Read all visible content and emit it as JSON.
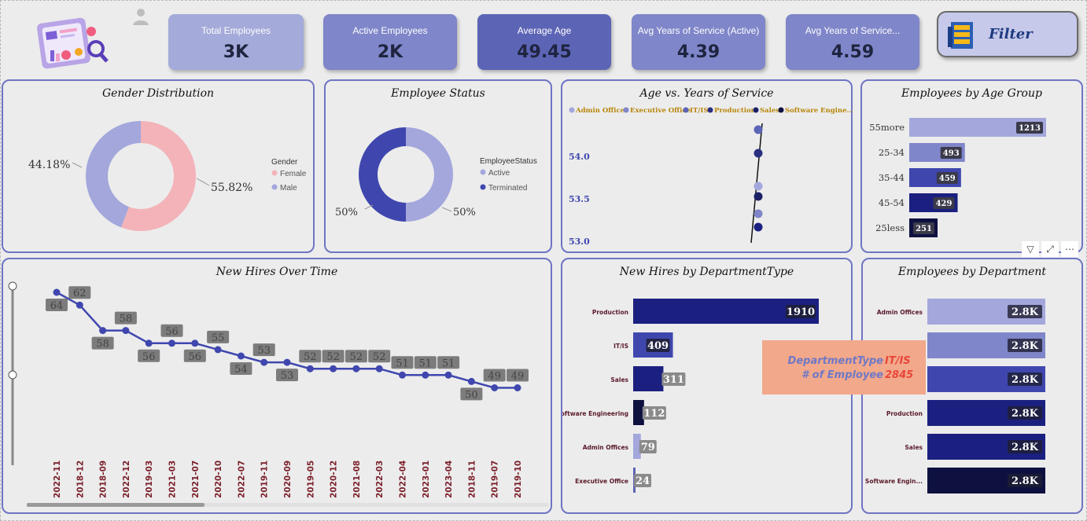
{
  "kpis": [
    {
      "label": "Total Employees",
      "value": "3K",
      "color": "#a4aad9"
    },
    {
      "label": "Active Employees",
      "value": "2K",
      "color": "#7f86c9"
    },
    {
      "label": "Average Age",
      "value": "49.45",
      "color": "#5c64b5"
    },
    {
      "label": "Avg Years of Service (Active)",
      "value": "4.39",
      "color": "#7f86c9"
    },
    {
      "label": "Avg Years of Service...",
      "value": "4.59",
      "color": "#7f86c9"
    }
  ],
  "filter": {
    "label": "Filter",
    "icon": "filter-panel-icon"
  },
  "gender": {
    "title": "Gender Distribution",
    "legend_title": "Gender",
    "items": [
      {
        "name": "Female",
        "pct": 55.82,
        "label": "55.82%",
        "color": "#f3b3b9"
      },
      {
        "name": "Male",
        "pct": 44.18,
        "label": "44.18%",
        "color": "#a3a7dc"
      }
    ]
  },
  "status": {
    "title": "Employee Status",
    "legend_title": "EmployeeStatus",
    "items": [
      {
        "name": "Active",
        "pct": 50,
        "label": "50%",
        "color": "#a3a7dc"
      },
      {
        "name": "Terminated",
        "pct": 50,
        "label": "50%",
        "color": "#3f47ae"
      }
    ]
  },
  "scatter": {
    "title": "Age vs. Years of Service",
    "legend": [
      {
        "name": "Admin Offices",
        "color": "#a3a7dc"
      },
      {
        "name": "Executive Office",
        "color": "#7f86c9"
      },
      {
        "name": "IT/IS",
        "color": "#5c64b5"
      },
      {
        "name": "Production",
        "color": "#2b2f80"
      },
      {
        "name": "Sales",
        "color": "#1c2066"
      },
      {
        "name": "Software Engine...",
        "color": "#0e1140"
      }
    ],
    "yticks": [
      "54.0",
      "53.5",
      "53.0"
    ]
  },
  "age_group": {
    "title": "Employees by Age Group",
    "items": [
      {
        "label": "55more",
        "value": 1213,
        "display": "1213",
        "color": "#a3a7dc"
      },
      {
        "label": "25-34",
        "value": 493,
        "display": "493",
        "color": "#7f86c9"
      },
      {
        "label": "35-44",
        "value": 459,
        "display": "459",
        "color": "#3f47ae"
      },
      {
        "label": "45-54",
        "value": 429,
        "display": "429",
        "color": "#1b2080"
      },
      {
        "label": "25less",
        "value": 251,
        "display": "251",
        "color": "#0e1140"
      }
    ]
  },
  "hires": {
    "title": "New Hires Over Time",
    "categories": [
      "2022-11",
      "2018-12",
      "2018-09",
      "2022-12",
      "2019-03",
      "2021-03",
      "2021-07",
      "2020-10",
      "2022-07",
      "2019-11",
      "2020-09",
      "2019-05",
      "2020-12",
      "2021-08",
      "2022-03",
      "2022-04",
      "2023-01",
      "2023-04",
      "2018-11",
      "2019-07",
      "2019-10"
    ],
    "labels": [
      "64",
      "62",
      "58",
      "58",
      "56",
      "56",
      "56",
      "55",
      "54",
      "53",
      "53",
      "52",
      "52",
      "52",
      "52",
      "51",
      "51",
      "51",
      "50",
      "49",
      "49"
    ]
  },
  "dept_hires": {
    "title": "New Hires by DepartmentType",
    "items": [
      {
        "label": "Production",
        "value": 1910,
        "display": "1910",
        "color": "#1b2080"
      },
      {
        "label": "IT/IS",
        "value": 409,
        "display": "409",
        "color": "#3f47ae"
      },
      {
        "label": "Sales",
        "value": 311,
        "display": "311",
        "color": "#1b2080"
      },
      {
        "label": "Software Engineering",
        "value": 112,
        "display": "112",
        "color": "#0e1140"
      },
      {
        "label": "Admin Offices",
        "value": 79,
        "display": "79",
        "color": "#a3a7dc"
      },
      {
        "label": "Executive Office",
        "value": 24,
        "display": "24",
        "color": "#5c64b5"
      }
    ]
  },
  "tooltip": {
    "k1": "DepartmentType",
    "v1": "IT/IS",
    "k2": "# of Employee",
    "v2": "2845"
  },
  "dept_emp": {
    "title": "Employees by Department",
    "items": [
      {
        "label": "Admin Offices",
        "display": "2.8K",
        "color": "#a3a7dc"
      },
      {
        "label": "",
        "display": "2.8K",
        "color": "#7f86c9"
      },
      {
        "label": "",
        "display": "2.8K",
        "color": "#3f47ae"
      },
      {
        "label": "Production",
        "display": "2.8K",
        "color": "#1b2080"
      },
      {
        "label": "Sales",
        "display": "2.8K",
        "color": "#1b2080"
      },
      {
        "label": "Software Engin...",
        "display": "2.8K",
        "color": "#0e1140"
      }
    ]
  },
  "visual_icons": [
    "filter-icon",
    "expand-icon",
    "more-options-icon"
  ]
}
